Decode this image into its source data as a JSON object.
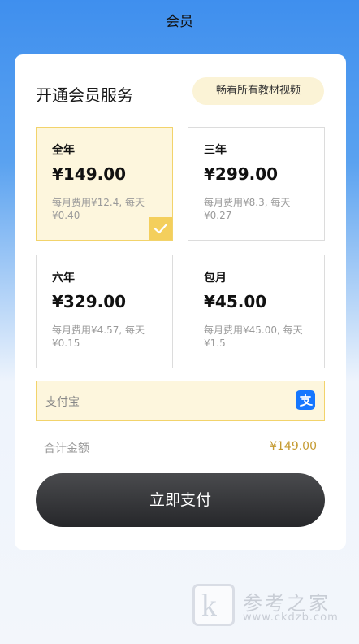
{
  "header": {
    "title": "会员"
  },
  "card": {
    "title": "开通会员服务",
    "pill": "畅看所有教材视频"
  },
  "plans": [
    {
      "name": "全年",
      "price": "¥149.00",
      "desc": "每月费用¥12.4, 每天¥0.40",
      "selected": true
    },
    {
      "name": "三年",
      "price": "¥299.00",
      "desc": "每月费用¥8.3, 每天¥0.27",
      "selected": false
    },
    {
      "name": "六年",
      "price": "¥329.00",
      "desc": "每月费用¥4.57, 每天¥0.15",
      "selected": false
    },
    {
      "name": "包月",
      "price": "¥45.00",
      "desc": "每月费用¥45.00, 每天¥1.5",
      "selected": false
    }
  ],
  "payment": {
    "method": "支付宝",
    "icon": "alipay-icon"
  },
  "total": {
    "label": "合计金额",
    "value": "¥149.00"
  },
  "pay_button": "立即支付",
  "watermark": {
    "logo": "k",
    "name": "参考之家",
    "url": "www.ckdzb.com"
  },
  "colors": {
    "accent": "#f4cf5c",
    "selected_bg": "#fdf6dd",
    "price_total": "#c59b32",
    "button": "#333438",
    "alipay": "#1677ff"
  }
}
